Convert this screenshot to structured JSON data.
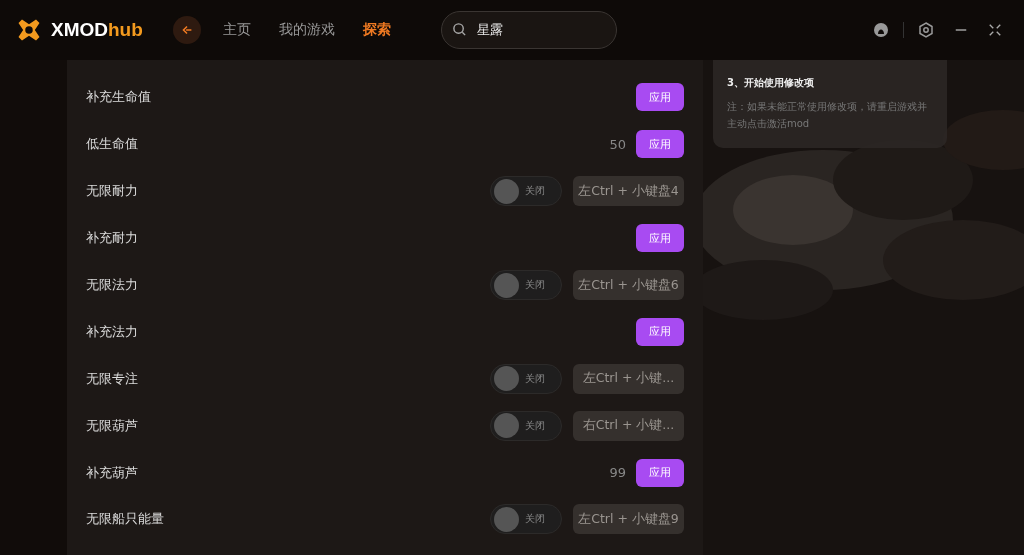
{
  "app": {
    "logo_main": "XMOD",
    "logo_accent": "hub"
  },
  "nav": [
    {
      "label": "主页",
      "selected": false
    },
    {
      "label": "我的游戏",
      "selected": false
    },
    {
      "label": "探索",
      "selected": true
    }
  ],
  "search": {
    "value": "星露"
  },
  "mods": [
    {
      "kind": "apply",
      "name": "补充生命值",
      "button": "应用"
    },
    {
      "kind": "apply",
      "name": "低生命值",
      "value": "50",
      "button": "应用"
    },
    {
      "kind": "toggle",
      "name": "无限耐力",
      "on": false,
      "state_label": "关闭",
      "hotkey": "左Ctrl + 小键盘4"
    },
    {
      "kind": "apply",
      "name": "补充耐力",
      "button": "应用"
    },
    {
      "kind": "toggle",
      "name": "无限法力",
      "on": false,
      "state_label": "关闭",
      "hotkey": "左Ctrl + 小键盘6"
    },
    {
      "kind": "apply",
      "name": "补充法力",
      "button": "应用"
    },
    {
      "kind": "toggle",
      "name": "无限专注",
      "on": false,
      "state_label": "关闭",
      "hotkey": "左Ctrl + 小键..."
    },
    {
      "kind": "toggle",
      "name": "无限葫芦",
      "on": false,
      "state_label": "关闭",
      "hotkey": "右Ctrl + 小键..."
    },
    {
      "kind": "apply",
      "name": "补充葫芦",
      "value": "99",
      "button": "应用"
    },
    {
      "kind": "toggle",
      "name": "无限船只能量",
      "on": false,
      "state_label": "关闭",
      "hotkey": "左Ctrl + 小键盘9"
    }
  ],
  "guide": {
    "step": "3、开始使用修改项",
    "note": "注：如果未能正常使用修改项，请重启游戏并主动点击激活mod"
  }
}
